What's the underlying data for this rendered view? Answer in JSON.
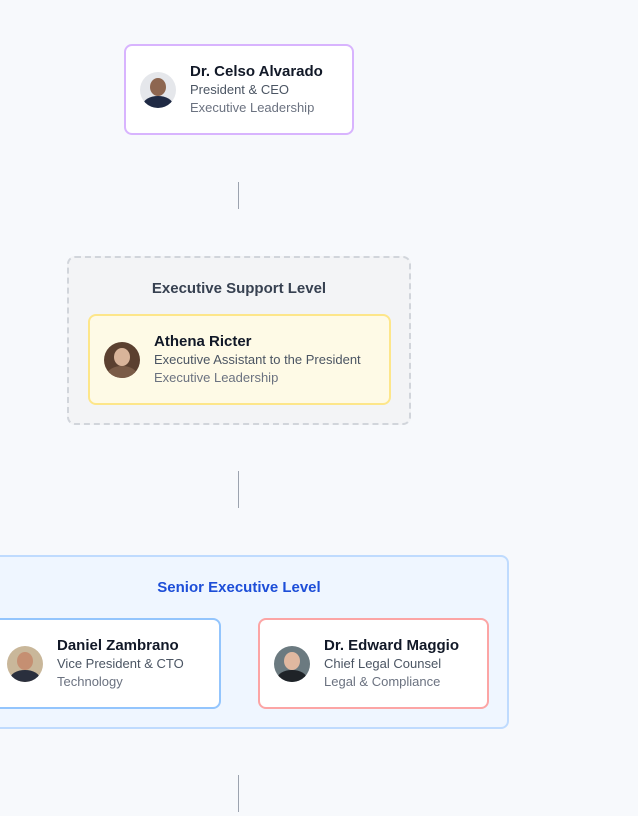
{
  "ceo": {
    "name": "Dr. Celso Alvarado",
    "title": "President & CEO",
    "department": "Executive Leadership"
  },
  "support_level": {
    "title": "Executive Support Level",
    "members": [
      {
        "name": "Athena Ricter",
        "title": "Executive Assistant to the President",
        "department": "Executive Leadership"
      }
    ]
  },
  "senior_level": {
    "title": "Senior Executive Level",
    "members": [
      {
        "name": "Daniel Zambrano",
        "title": "Vice President & CTO",
        "department": "Technology"
      },
      {
        "name": "Dr. Edward Maggio",
        "title": "Chief Legal Counsel",
        "department": "Legal & Compliance"
      }
    ]
  },
  "colors": {
    "ceo_border": "#d8b4fe",
    "support_border": "#fde68a",
    "senior_title": "#1d4ed8",
    "cto_border": "#93c5fd",
    "legal_border": "#fca5a5"
  }
}
